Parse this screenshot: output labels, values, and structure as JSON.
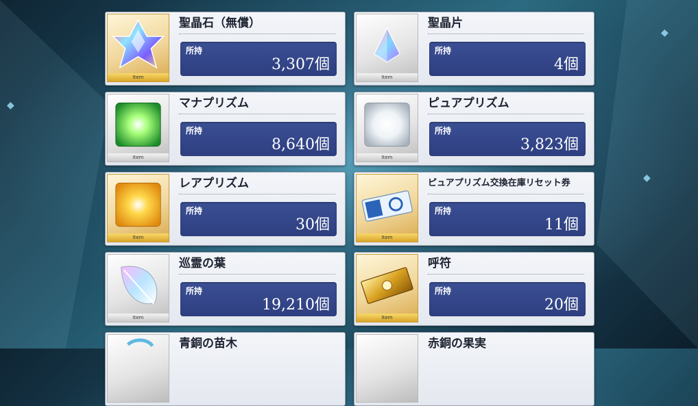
{
  "owned_label": "所持",
  "item_tag": "Item",
  "items": [
    {
      "name": "聖晶石（無償）",
      "count": "3,307個",
      "icon": "saint-quartz-icon",
      "frame": "gold"
    },
    {
      "name": "聖晶片",
      "count": "4個",
      "icon": "quartz-fragment-icon",
      "frame": "silver"
    },
    {
      "name": "マナプリズム",
      "count": "8,640個",
      "icon": "mana-prism-icon",
      "frame": "silver"
    },
    {
      "name": "ピュアプリズム",
      "count": "3,823個",
      "icon": "pure-prism-icon",
      "frame": "silver"
    },
    {
      "name": "レアプリズム",
      "count": "30個",
      "icon": "rare-prism-icon",
      "frame": "gold"
    },
    {
      "name": "ピュアプリズム交換在庫リセット券",
      "count": "11個",
      "icon": "reset-ticket-icon",
      "frame": "gold"
    },
    {
      "name": "巡霊の葉",
      "count": "19,210個",
      "icon": "spirit-leaf-icon",
      "frame": "silver"
    },
    {
      "name": "呼符",
      "count": "20個",
      "icon": "summon-ticket-icon",
      "frame": "gold"
    },
    {
      "name": "青銅の苗木",
      "count": "",
      "icon": "bronze-sapling-icon",
      "frame": "silver"
    },
    {
      "name": "赤銅の果実",
      "count": "",
      "icon": "copper-fruit-icon",
      "frame": "silver"
    }
  ],
  "colors": {
    "panel": "#2e3f80",
    "gold_frame": "#d9a52a"
  }
}
